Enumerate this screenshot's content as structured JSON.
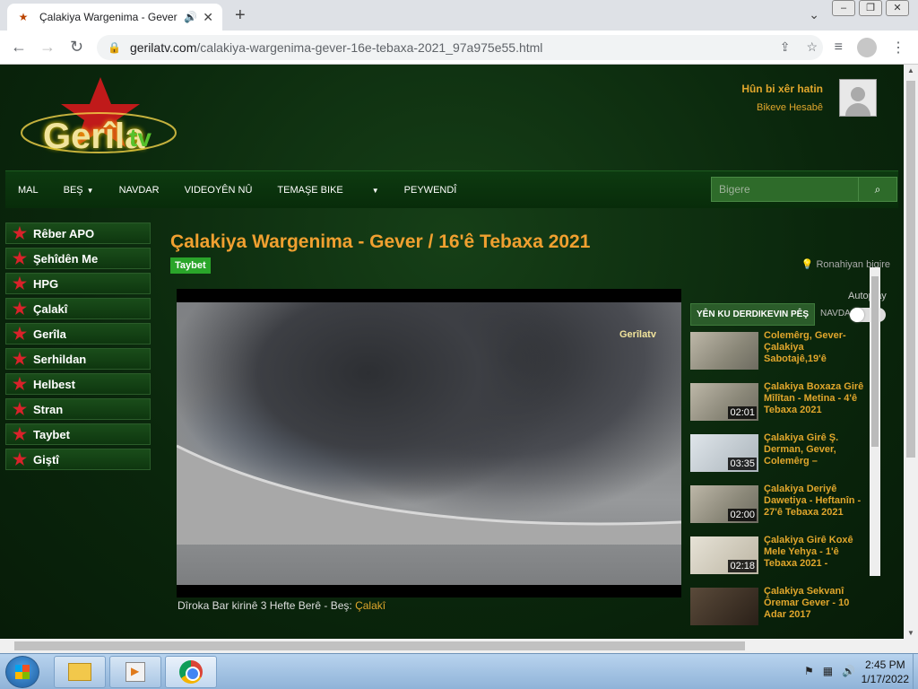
{
  "browser": {
    "tab_title": "Çalakiya Wargenima - Gever",
    "url_host": "gerilatv.com",
    "url_path": "/calakiya-wargenima-gever-16e-tebaxa-2021_97a975e55.html",
    "icons": [
      "back-icon",
      "forward-icon",
      "reload-icon",
      "lock-icon",
      "share-icon",
      "star-icon",
      "media-control-icon",
      "profile-icon",
      "menu-icon"
    ]
  },
  "site": {
    "logo_text": "Gerîla",
    "logo_tv": "tv",
    "welcome": "Hûn bi xêr hatin",
    "account": "Bikeve Hesabê",
    "nav": [
      {
        "label": "MAL"
      },
      {
        "label": "BEŞ",
        "caret": "▼"
      },
      {
        "label": "NAVDAR"
      },
      {
        "label": "VIDEOYÊN NÛ"
      },
      {
        "label": "TEMAŞE BIKE"
      },
      {
        "label": "",
        "caret": "▼"
      },
      {
        "label": "PEYWENDÎ"
      }
    ],
    "search_placeholder": "Bigere",
    "sidebar": [
      "Rêber APO",
      "Şehîdên Me",
      "HPG",
      "Çalakî",
      "Gerîla",
      "Serhildan",
      "Helbest",
      "Stran",
      "Taybet",
      "Giştî"
    ],
    "video_title": "Çalakiya Wargenima - Gever / 16'ê Tebaxa 2021",
    "badge": "Taybet",
    "report": "Ronahiyan bigire",
    "video_watermark": "Gerîlatv",
    "caption_text": "Dîroka Bar kirinê 3 Hefte Berê - Beş: ",
    "caption_link": "Çalakî",
    "autoplay": "Autoplay",
    "up_next": "YÊN KU DERDIKEVIN PÊŞ",
    "navda": "NAVDA",
    "related": [
      {
        "title": "Colemêrg, Gever-Çalakiya Sabotajê,19'ê",
        "duration": ""
      },
      {
        "title": "Çalakiya Boxaza Girê Mîlîtan - Metina - 4'ê Tebaxa 2021",
        "duration": "02:01"
      },
      {
        "title": "Çalakiya Girê Ş. Derman, Gever, Colemêrg –",
        "duration": "03:35"
      },
      {
        "title": "Çalakiya Deriyê Dawetiya - Heftanîn - 27'ê Tebaxa 2021",
        "duration": "02:00"
      },
      {
        "title": "Çalakiya Girê Koxê Mele Yehya - 1'ê Tebaxa 2021 -",
        "duration": "02:18"
      },
      {
        "title": "Çalakiya Sekvanî Ôremar Gever - 10 Adar 2017",
        "duration": ""
      }
    ]
  },
  "taskbar": {
    "time": "2:45 PM",
    "date": "1/17/2022"
  }
}
